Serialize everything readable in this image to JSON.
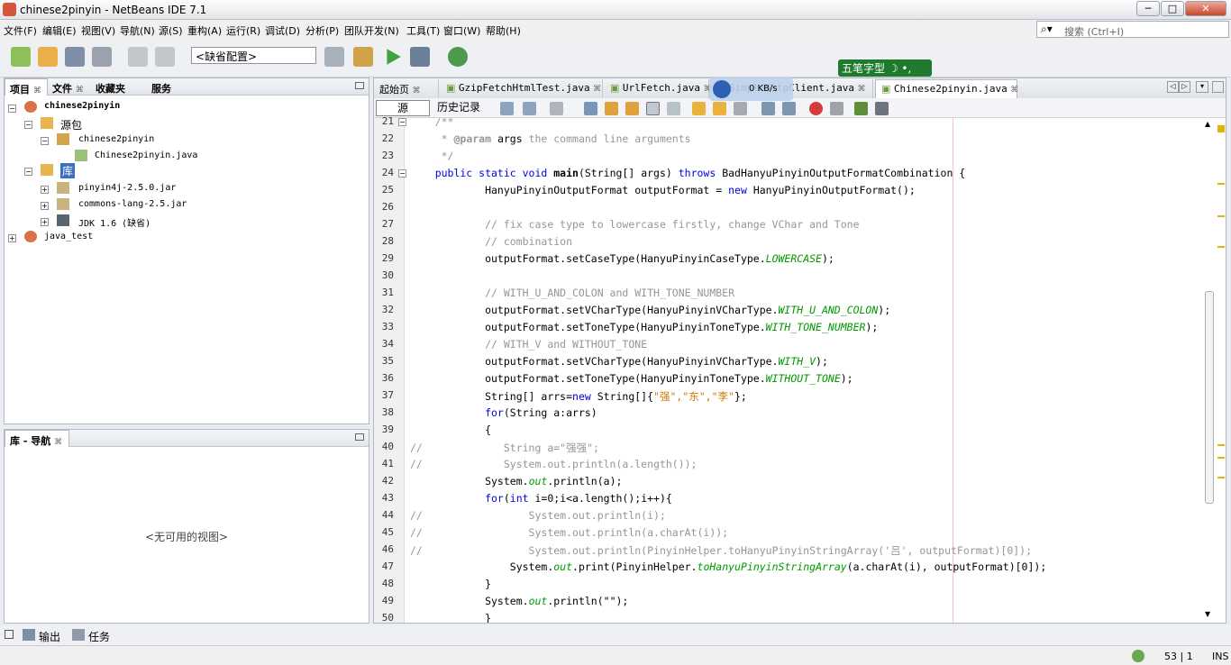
{
  "window": {
    "title": "chinese2pinyin - NetBeans IDE 7.1",
    "min_label": "─",
    "max_label": "□",
    "close_label": "✕"
  },
  "menu": [
    "文件(F)",
    "编辑(E)",
    "视图(V)",
    "导航(N)",
    "源(S)",
    "重构(A)",
    "运行(R)",
    "调试(D)",
    "分析(P)",
    "团队开发(N)",
    "工具(T)",
    "窗口(W)",
    "帮助(H)"
  ],
  "search": {
    "placeholder": "搜索  (Ctrl+I)"
  },
  "toolbar": {
    "config": "<缺省配置>"
  },
  "ime": {
    "label": "五笔字型 ☽ •,"
  },
  "speed": {
    "label": "0 KB/s"
  },
  "project_panel": {
    "tabs": [
      "项目",
      "文件",
      "收藏夹",
      "服务"
    ],
    "tree": [
      "chinese2pinyin",
      "源包",
      "chinese2pinyin",
      "Chinese2pinyin.java",
      "库",
      "pinyin4j-2.5.0.jar",
      "commons-lang-2.5.jar",
      "JDK 1.6 (缺省)",
      "java_test"
    ]
  },
  "nav_panel": {
    "title": "库 - 导航",
    "empty": "<无可用的视图>"
  },
  "editor": {
    "tabs": [
      "起始页",
      "GzipFetchHtmlTest.java",
      "UrlFetch.java",
      "SimpleHttpClient.java",
      "Chinese2pinyin.java"
    ],
    "source_btn": "源",
    "history_btn": "历史记录",
    "lines": [
      {
        "n": "21",
        "segs": [
          {
            "c": "cm",
            "t": "    /**"
          }
        ],
        "fold": true
      },
      {
        "n": "22",
        "segs": [
          {
            "c": "cm",
            "t": "     * "
          },
          {
            "c": "cm bf",
            "t": "@param"
          },
          {
            "c": "",
            "t": " args"
          },
          {
            "c": "cm",
            "t": " the command line arguments"
          }
        ]
      },
      {
        "n": "23",
        "segs": [
          {
            "c": "cm",
            "t": "     */"
          }
        ]
      },
      {
        "n": "24",
        "segs": [
          {
            "c": "kw",
            "t": "    public static void "
          },
          {
            "c": "bf",
            "t": "main"
          },
          {
            "c": "",
            "t": "(String[] args) "
          },
          {
            "c": "kw",
            "t": "throws"
          },
          {
            "c": "",
            "t": " BadHanyuPinyinOutputFormatCombination {"
          }
        ],
        "fold": true
      },
      {
        "n": "25",
        "segs": [
          {
            "c": "",
            "t": "            HanyuPinyinOutputFormat outputFormat = "
          },
          {
            "c": "kw",
            "t": "new"
          },
          {
            "c": "",
            "t": " HanyuPinyinOutputFormat();"
          }
        ]
      },
      {
        "n": "26",
        "segs": [
          {
            "c": "",
            "t": ""
          }
        ]
      },
      {
        "n": "27",
        "segs": [
          {
            "c": "cm",
            "t": "            // fix case type to lowercase firstly, change VChar and Tone"
          }
        ]
      },
      {
        "n": "28",
        "segs": [
          {
            "c": "cm",
            "t": "            // combination"
          }
        ]
      },
      {
        "n": "29",
        "segs": [
          {
            "c": "",
            "t": "            outputFormat.setCaseType(HanyuPinyinCaseType."
          },
          {
            "c": "it",
            "t": "LOWERCASE"
          },
          {
            "c": "",
            "t": ");"
          }
        ]
      },
      {
        "n": "30",
        "segs": [
          {
            "c": "",
            "t": ""
          }
        ]
      },
      {
        "n": "31",
        "segs": [
          {
            "c": "cm",
            "t": "            // WITH_U_AND_COLON and WITH_TONE_NUMBER"
          }
        ]
      },
      {
        "n": "32",
        "segs": [
          {
            "c": "",
            "t": "            outputFormat.setVCharType(HanyuPinyinVCharType."
          },
          {
            "c": "it",
            "t": "WITH_U_AND_COLON"
          },
          {
            "c": "",
            "t": ");"
          }
        ]
      },
      {
        "n": "33",
        "segs": [
          {
            "c": "",
            "t": "            outputFormat.setToneType(HanyuPinyinToneType."
          },
          {
            "c": "it",
            "t": "WITH_TONE_NUMBER"
          },
          {
            "c": "",
            "t": ");"
          }
        ]
      },
      {
        "n": "34",
        "segs": [
          {
            "c": "cm",
            "t": "            // WITH_V and WITHOUT_TONE"
          }
        ]
      },
      {
        "n": "35",
        "segs": [
          {
            "c": "",
            "t": "            outputFormat.setVCharType(HanyuPinyinVCharType."
          },
          {
            "c": "it",
            "t": "WITH_V"
          },
          {
            "c": "",
            "t": ");"
          }
        ]
      },
      {
        "n": "36",
        "segs": [
          {
            "c": "",
            "t": "            outputFormat.setToneType(HanyuPinyinToneType."
          },
          {
            "c": "it",
            "t": "WITHOUT_TONE"
          },
          {
            "c": "",
            "t": ");"
          }
        ]
      },
      {
        "n": "37",
        "segs": [
          {
            "c": "",
            "t": "            String[] arrs="
          },
          {
            "c": "kw",
            "t": "new"
          },
          {
            "c": "",
            "t": " String[]{"
          },
          {
            "c": "st",
            "t": "\"强\",\"东\",\"李\""
          },
          {
            "c": "",
            "t": "};"
          }
        ]
      },
      {
        "n": "38",
        "segs": [
          {
            "c": "kw",
            "t": "            for"
          },
          {
            "c": "",
            "t": "(String a:arrs)"
          }
        ]
      },
      {
        "n": "39",
        "segs": [
          {
            "c": "",
            "t": "            {"
          }
        ]
      },
      {
        "n": "40",
        "segs": [
          {
            "c": "cm",
            "t": "//             String a=\"强强\";"
          }
        ]
      },
      {
        "n": "41",
        "segs": [
          {
            "c": "cm",
            "t": "//             System.out.println(a.length());"
          }
        ]
      },
      {
        "n": "42",
        "segs": [
          {
            "c": "",
            "t": "            System."
          },
          {
            "c": "it",
            "t": "out"
          },
          {
            "c": "",
            "t": ".println(a);"
          }
        ]
      },
      {
        "n": "43",
        "segs": [
          {
            "c": "kw",
            "t": "            for"
          },
          {
            "c": "",
            "t": "("
          },
          {
            "c": "kw",
            "t": "int"
          },
          {
            "c": "",
            "t": " i=0;i<a.length();i++){"
          }
        ]
      },
      {
        "n": "44",
        "segs": [
          {
            "c": "cm",
            "t": "//                 System.out.println(i);"
          }
        ]
      },
      {
        "n": "45",
        "segs": [
          {
            "c": "cm",
            "t": "//                 System.out.println(a.charAt(i));"
          }
        ]
      },
      {
        "n": "46",
        "segs": [
          {
            "c": "cm",
            "t": "//                 System.out.println(PinyinHelper.toHanyuPinyinStringArray('吕', outputFormat)[0]);"
          }
        ]
      },
      {
        "n": "47",
        "segs": [
          {
            "c": "",
            "t": "                System."
          },
          {
            "c": "it",
            "t": "out"
          },
          {
            "c": "",
            "t": ".print(PinyinHelper."
          },
          {
            "c": "it",
            "t": "toHanyuPinyinStringArray"
          },
          {
            "c": "",
            "t": "(a.charAt(i), outputFormat)[0]);"
          }
        ]
      },
      {
        "n": "48",
        "segs": [
          {
            "c": "",
            "t": "            }"
          }
        ]
      },
      {
        "n": "49",
        "segs": [
          {
            "c": "",
            "t": "            System."
          },
          {
            "c": "it",
            "t": "out"
          },
          {
            "c": "",
            "t": ".println(\"\");"
          }
        ]
      },
      {
        "n": "50",
        "segs": [
          {
            "c": "",
            "t": "            }"
          }
        ]
      }
    ]
  },
  "bottom": {
    "output": "输出",
    "tasks": "任务"
  },
  "status": {
    "position": "53 | 1",
    "mode": "INS"
  }
}
